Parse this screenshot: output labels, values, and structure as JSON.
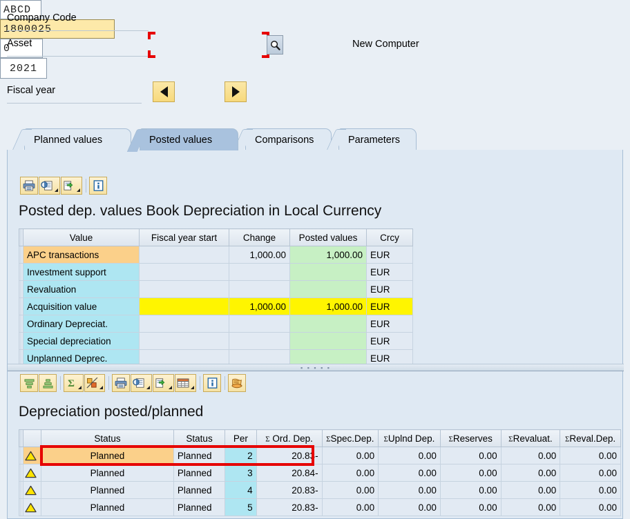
{
  "header": {
    "company_code_label": "Company Code",
    "company_code_value": "ABCD",
    "asset_label": "Asset",
    "asset_value": "1800025",
    "asset_subnumber_value": "0",
    "asset_description": "New Computer",
    "fiscal_year_label": "Fiscal year",
    "fiscal_year_value": "2021",
    "prev_year_icon": "triangle-left-icon",
    "next_year_icon": "triangle-right-icon",
    "search_help_icon": "magnifier-icon"
  },
  "tabs": [
    {
      "label": "Planned values",
      "selected": false
    },
    {
      "label": "Posted values",
      "selected": true
    },
    {
      "label": "Comparisons",
      "selected": false
    },
    {
      "label": "Parameters",
      "selected": false
    }
  ],
  "upper_section": {
    "toolbar": [
      {
        "name": "print-icon",
        "has_caret": false
      },
      {
        "name": "print-preview-icon",
        "has_caret": true
      },
      {
        "name": "export-icon",
        "has_caret": true
      },
      {
        "name": "separator",
        "has_caret": false
      },
      {
        "name": "info-icon",
        "has_caret": false
      }
    ],
    "title": "Posted dep. values Book Depreciation in Local Currency",
    "columns": [
      "Value",
      "Fiscal year start",
      "Change",
      "Posted values",
      "Crcy"
    ],
    "rows": [
      {
        "value": "APC transactions",
        "fiscal_year_start": "",
        "change": "1,000.00",
        "posted_values": "1,000.00",
        "crcy": "EUR",
        "value_color": "#fbd08a",
        "row_color": "normal"
      },
      {
        "value": "Investment support",
        "fiscal_year_start": "",
        "change": "",
        "posted_values": "",
        "crcy": "EUR",
        "value_color": "#aee6f2",
        "row_color": "normal"
      },
      {
        "value": "Revaluation",
        "fiscal_year_start": "",
        "change": "",
        "posted_values": "",
        "crcy": "EUR",
        "value_color": "#aee6f2",
        "row_color": "normal"
      },
      {
        "value": "Acquisition value",
        "fiscal_year_start": "",
        "change": "1,000.00",
        "posted_values": "1,000.00",
        "crcy": "EUR",
        "value_color": "#aee6f2",
        "row_color": "yellow"
      },
      {
        "value": "Ordinary Depreciat.",
        "fiscal_year_start": "",
        "change": "",
        "posted_values": "",
        "crcy": "EUR",
        "value_color": "#aee6f2",
        "row_color": "normal"
      },
      {
        "value": "Special depreciation",
        "fiscal_year_start": "",
        "change": "",
        "posted_values": "",
        "crcy": "EUR",
        "value_color": "#aee6f2",
        "row_color": "normal"
      },
      {
        "value": "Unplanned Deprec.",
        "fiscal_year_start": "",
        "change": "",
        "posted_values": "",
        "crcy": "EUR",
        "value_color": "#aee6f2",
        "row_color": "normal"
      }
    ]
  },
  "lower_section": {
    "toolbar": [
      {
        "name": "sort-ascending-icon",
        "has_caret": false
      },
      {
        "name": "sort-descending-icon",
        "has_caret": false
      },
      {
        "name": "separator",
        "has_caret": false
      },
      {
        "name": "sum-icon",
        "has_caret": true
      },
      {
        "name": "subtotal-icon",
        "has_caret": true
      },
      {
        "name": "separator",
        "has_caret": false
      },
      {
        "name": "print-icon",
        "has_caret": false
      },
      {
        "name": "print-preview-icon",
        "has_caret": true
      },
      {
        "name": "export-icon",
        "has_caret": true
      },
      {
        "name": "layout-icon",
        "has_caret": true
      },
      {
        "name": "separator",
        "has_caret": false
      },
      {
        "name": "info-icon",
        "has_caret": false
      },
      {
        "name": "separator",
        "has_caret": false
      },
      {
        "name": "history-icon",
        "has_caret": false
      }
    ],
    "title": "Depreciation posted/planned",
    "columns": [
      "Status",
      "Status",
      "Per",
      "Ord. Dep.",
      "Spec.Dep.",
      "Uplnd Dep.",
      "Reserves",
      "Revaluat.",
      "Reval.Dep."
    ],
    "sigma_columns": [
      3,
      4,
      5,
      6,
      7,
      8
    ],
    "rows": [
      {
        "icon": "warning-triangle-icon",
        "status1": "Planned",
        "status2": "Planned",
        "per": "2",
        "ord_dep": "20.83-",
        "spec_dep": "0.00",
        "uplnd_dep": "0.00",
        "reserves": "0.00",
        "revaluat": "0.00",
        "reval_dep": "0.00",
        "highlighted": true
      },
      {
        "icon": "warning-triangle-icon",
        "status1": "Planned",
        "status2": "Planned",
        "per": "3",
        "ord_dep": "20.84-",
        "spec_dep": "0.00",
        "uplnd_dep": "0.00",
        "reserves": "0.00",
        "revaluat": "0.00",
        "reval_dep": "0.00",
        "highlighted": false
      },
      {
        "icon": "warning-triangle-icon",
        "status1": "Planned",
        "status2": "Planned",
        "per": "4",
        "ord_dep": "20.83-",
        "spec_dep": "0.00",
        "uplnd_dep": "0.00",
        "reserves": "0.00",
        "revaluat": "0.00",
        "reval_dep": "0.00",
        "highlighted": false
      },
      {
        "icon": "warning-triangle-icon",
        "status1": "Planned",
        "status2": "Planned",
        "per": "5",
        "ord_dep": "20.83-",
        "spec_dep": "0.00",
        "uplnd_dep": "0.00",
        "reserves": "0.00",
        "revaluat": "0.00",
        "reval_dep": "0.00",
        "highlighted": false
      }
    ]
  },
  "annotations": {
    "asset_field_bracket_color": "#e60000",
    "planned_row_rect_color": "#e60000"
  },
  "colors": {
    "background": "#e9eff5",
    "panel": "#dfe9f3",
    "tab_selected": "#a9c2de",
    "focus_field": "#fde9a9",
    "grid_cell": "#e2eaf3",
    "cyan": "#aee6f2",
    "orange": "#fbd08a",
    "yellow": "#fff500",
    "green": "#c7f0c4"
  }
}
